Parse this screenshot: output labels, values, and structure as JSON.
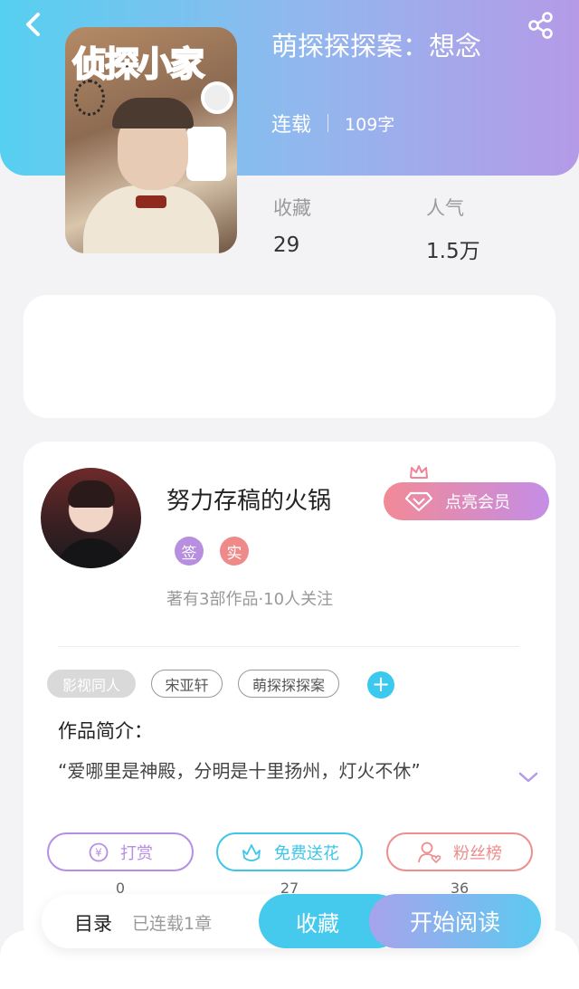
{
  "header": {
    "book_title": "萌探探探案：想念",
    "status": "连载",
    "word_count": "109字",
    "cover_art_text": "侦探小家"
  },
  "stats": [
    {
      "label": "收藏",
      "value": "29"
    },
    {
      "label": "人气",
      "value": "1.5万"
    }
  ],
  "author": {
    "name": "努力存稿的火锅",
    "badges": [
      "签",
      "实"
    ],
    "info": "著有3部作品·10人关注",
    "vip_button": "点亮会员"
  },
  "tags": [
    "影视同人",
    "宋亚轩",
    "萌探探探案"
  ],
  "intro": {
    "heading": "作品简介：",
    "text": "“爱哪里是神殿，分明是十里扬州，灯火不休”"
  },
  "actions": [
    {
      "label": "打赏",
      "count": "0",
      "color": "#b58ee6",
      "icon": "yen-icon"
    },
    {
      "label": "免费送花",
      "count": "27",
      "color": "#3dc6e8",
      "icon": "flower-icon"
    },
    {
      "label": "粉丝榜",
      "count": "36",
      "color": "#ef8d8d",
      "icon": "fan-icon"
    }
  ],
  "bottom_bar": {
    "toc_label": "目录",
    "chapter_status": "已连载1章",
    "favorite_label": "收藏",
    "read_label": "开始阅读"
  },
  "colors": {
    "accent_cyan": "#45c9ec",
    "accent_purple": "#b59ae8",
    "badge_sign": "#b88fe0",
    "badge_real": "#ef8a8a"
  }
}
